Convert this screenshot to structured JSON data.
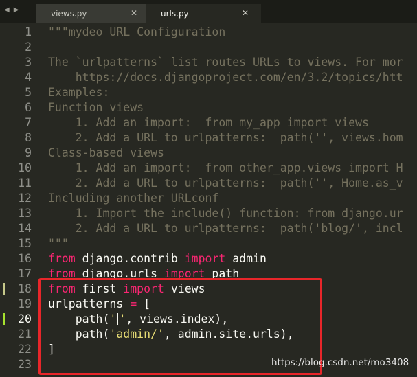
{
  "tabs": [
    {
      "label": "views.py",
      "active": false
    },
    {
      "label": "urls.py",
      "active": true
    }
  ],
  "nav": {
    "back_icon": "◀",
    "forward_icon": "▶"
  },
  "colors": {
    "background": "#272822",
    "keyword": "#f92672",
    "string": "#e6db74",
    "comment": "#75715e",
    "highlight_box": "#e8262a"
  },
  "editor": {
    "lines": [
      {
        "n": "1",
        "tokens": [
          {
            "t": "\"\"\"mydeo URL Configuration",
            "c": "comment"
          }
        ]
      },
      {
        "n": "2",
        "tokens": []
      },
      {
        "n": "3",
        "tokens": [
          {
            "t": "The `urlpatterns` list routes URLs to views. For mor",
            "c": "comment"
          }
        ]
      },
      {
        "n": "4",
        "tokens": [
          {
            "t": "    https://docs.djangoproject.com/en/3.2/topics/htt",
            "c": "comment"
          }
        ]
      },
      {
        "n": "5",
        "tokens": [
          {
            "t": "Examples:",
            "c": "comment"
          }
        ]
      },
      {
        "n": "6",
        "tokens": [
          {
            "t": "Function views",
            "c": "comment"
          }
        ]
      },
      {
        "n": "7",
        "tokens": [
          {
            "t": "    1. Add an import:  from my_app import views",
            "c": "comment"
          }
        ]
      },
      {
        "n": "8",
        "tokens": [
          {
            "t": "    2. Add a URL to urlpatterns:  path('', views.hom",
            "c": "comment"
          }
        ]
      },
      {
        "n": "9",
        "tokens": [
          {
            "t": "Class-based views",
            "c": "comment"
          }
        ]
      },
      {
        "n": "10",
        "tokens": [
          {
            "t": "    1. Add an import:  from other_app.views import H",
            "c": "comment"
          }
        ]
      },
      {
        "n": "11",
        "tokens": [
          {
            "t": "    2. Add a URL to urlpatterns:  path('', Home.as_v",
            "c": "comment"
          }
        ]
      },
      {
        "n": "12",
        "tokens": [
          {
            "t": "Including another URLconf",
            "c": "comment"
          }
        ]
      },
      {
        "n": "13",
        "tokens": [
          {
            "t": "    1. Import the include() function: from django.ur",
            "c": "comment"
          }
        ]
      },
      {
        "n": "14",
        "tokens": [
          {
            "t": "    2. Add a URL to urlpatterns:  path('blog/', incl",
            "c": "comment"
          }
        ]
      },
      {
        "n": "15",
        "tokens": [
          {
            "t": "\"\"\"",
            "c": "comment"
          }
        ]
      },
      {
        "n": "16",
        "tokens": [
          {
            "t": "from",
            "c": "keyword"
          },
          {
            "t": " django.contrib ",
            "c": "plain"
          },
          {
            "t": "import",
            "c": "keyword"
          },
          {
            "t": " admin",
            "c": "plain"
          }
        ]
      },
      {
        "n": "17",
        "tokens": [
          {
            "t": "from",
            "c": "keyword"
          },
          {
            "t": " django.urls ",
            "c": "plain"
          },
          {
            "t": "import",
            "c": "keyword"
          },
          {
            "t": " path",
            "c": "plain"
          }
        ]
      },
      {
        "n": "18",
        "mark": "#c6c98a",
        "tokens": [
          {
            "t": "from",
            "c": "keyword"
          },
          {
            "t": " first ",
            "c": "plain"
          },
          {
            "t": "import",
            "c": "keyword"
          },
          {
            "t": " views",
            "c": "plain"
          }
        ]
      },
      {
        "n": "19",
        "tokens": [
          {
            "t": "urlpatterns ",
            "c": "plain"
          },
          {
            "t": "=",
            "c": "keyword"
          },
          {
            "t": " [",
            "c": "plain"
          }
        ]
      },
      {
        "n": "20",
        "current": true,
        "mark": "#a6e22e",
        "tokens": [
          {
            "t": "    path(",
            "c": "plain"
          },
          {
            "t": "'",
            "c": "string"
          },
          {
            "t": "|",
            "c": "caret"
          },
          {
            "t": "'",
            "c": "string"
          },
          {
            "t": ", views.index),",
            "c": "plain"
          }
        ]
      },
      {
        "n": "21",
        "tokens": [
          {
            "t": "    path(",
            "c": "plain"
          },
          {
            "t": "'admin/'",
            "c": "string"
          },
          {
            "t": ", admin.site.urls),",
            "c": "plain"
          }
        ]
      },
      {
        "n": "22",
        "tokens": [
          {
            "t": "]",
            "c": "plain"
          }
        ]
      },
      {
        "n": "23",
        "tokens": []
      }
    ]
  },
  "watermark": "https://blog.csdn.net/mo3408"
}
